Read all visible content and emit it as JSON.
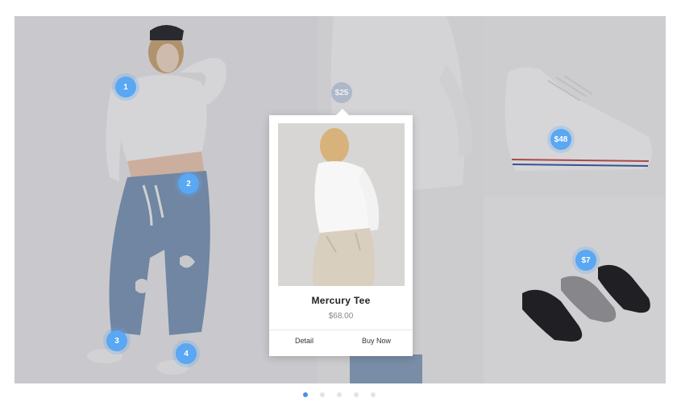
{
  "hotspots": {
    "h1": "1",
    "h2": "2",
    "h3": "3",
    "h4": "4",
    "top_price": "$25",
    "shoe_price": "$48",
    "socks_price": "$7"
  },
  "popup": {
    "name": "Mercury Tee",
    "price": "$68.00",
    "detail_label": "Detail",
    "buy_label": "Buy Now"
  },
  "pagination": {
    "total": 5,
    "active": 1
  },
  "colors": {
    "accent": "#5aa7f3",
    "active_dot": "#4a90e2",
    "inactive_dot": "#dfe3ea"
  }
}
